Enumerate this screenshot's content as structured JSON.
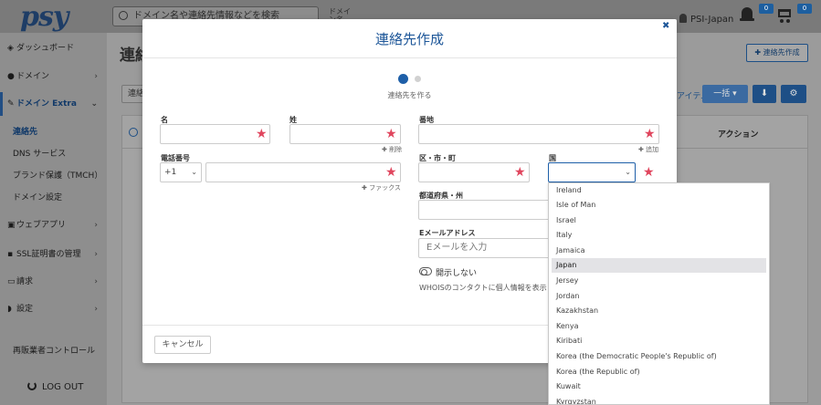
{
  "topbar": {
    "logo": "psy",
    "search_text": "ドメイン名や連絡先情報などを検索",
    "domain_filter_line1": "ドメイ",
    "domain_filter_line2": "ン名",
    "user_name": "PSI-Japan",
    "notifications_count": "0",
    "cart_count": "0"
  },
  "sidebar": {
    "dashboard": "ダッシュボード",
    "domains": "ドメイン",
    "domain_extra": "ドメイン Extra",
    "sub_items": [
      "連絡先",
      "DNS サービス",
      "ブランド保護（TMCH）",
      "ドメイン設定"
    ],
    "web_apps": "ウェブアプリ",
    "ssl": "SSL証明書の管理",
    "billing": "請求",
    "settings": "設定",
    "reseller": "再販業者コントロール",
    "logout": "LOG OUT"
  },
  "page": {
    "title": "連絡先",
    "add_contact_button": "連絡先作成",
    "tab_label": "連絡",
    "items_label": "アイテム",
    "bulk_button": "一括",
    "action_column": "アクション"
  },
  "modal": {
    "title": "連絡先作成",
    "step_label": "連絡先を作る",
    "fields": {
      "first_name": "名",
      "last_name": "姓",
      "address": "番地",
      "phone": "電話番号",
      "city": "区・市・町",
      "country": "国",
      "prefecture": "都道府県・州",
      "email": "Eメールアドレス"
    },
    "phone_code": "+1",
    "email_placeholder": "Eメールを入力",
    "add_link_name": "削除",
    "add_link_address": "追加",
    "fax_link": "ファックス",
    "toggle_label": "開示しない",
    "whois_note": "WHOISのコンタクトに個人情報を表示しない",
    "cancel_button": "キャンセル"
  },
  "country_dropdown": {
    "selected": "Japan",
    "options": [
      "Ireland",
      "Isle of Man",
      "Israel",
      "Italy",
      "Jamaica",
      "Japan",
      "Jersey",
      "Jordan",
      "Kazakhstan",
      "Kenya",
      "Kiribati",
      "Korea (the Democratic People's Republic of)",
      "Korea (the Republic of)",
      "Kuwait",
      "Kyrgyzstan"
    ]
  },
  "colors": {
    "brand_blue": "#1e5799",
    "required_star": "#e0465e",
    "active_step": "#1e5fa8"
  }
}
